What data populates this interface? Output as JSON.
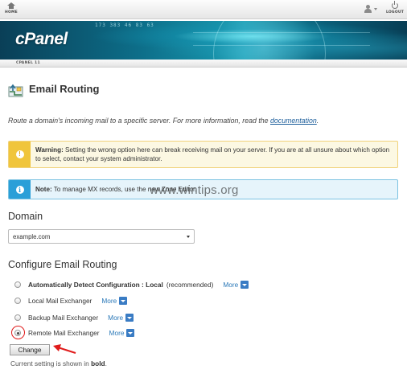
{
  "topbar": {
    "home_label": "HOME",
    "logout_label": "LOGOUT",
    "home_icon": "home-icon",
    "user_icon": "user-icon",
    "logout_icon": "power-icon"
  },
  "banner": {
    "brand": "cPanel",
    "digits": "173  383 46  83 63",
    "version": "CPANEL 11"
  },
  "page": {
    "title": "Email Routing",
    "title_icon": "email-routing-icon",
    "intro_text": "Route a domain's incoming mail to a specific server. For more information, read the ",
    "intro_link": "documentation",
    "intro_end": "."
  },
  "warning": {
    "label": "Warning:",
    "text": " Setting the wrong option here can break receiving mail on your server. If you are at all unsure about which option to select, contact your system administrator.",
    "color": "#f0c53c"
  },
  "note": {
    "label": "Note:",
    "text": " To manage MX records, use the new Zone Editor.",
    "color": "#2a9fd8"
  },
  "watermark": "www.wintips.org",
  "domain": {
    "heading": "Domain",
    "selected": "example.com"
  },
  "routing": {
    "heading": "Configure Email Routing",
    "options": [
      {
        "label_bold": "Automatically Detect Configuration : Local",
        "label_extra": "(recommended)",
        "checked": false
      },
      {
        "label": "Local Mail Exchanger",
        "checked": false
      },
      {
        "label": "Backup Mail Exchanger",
        "checked": false
      },
      {
        "label": "Remote Mail Exchanger",
        "checked": true
      }
    ],
    "more_label": "More",
    "change_button": "Change",
    "current_prefix": "Current setting is shown in ",
    "current_bold": "bold",
    "current_suffix": "."
  },
  "colors": {
    "link": "#2a78b8",
    "annotation": "#e01b1b"
  }
}
